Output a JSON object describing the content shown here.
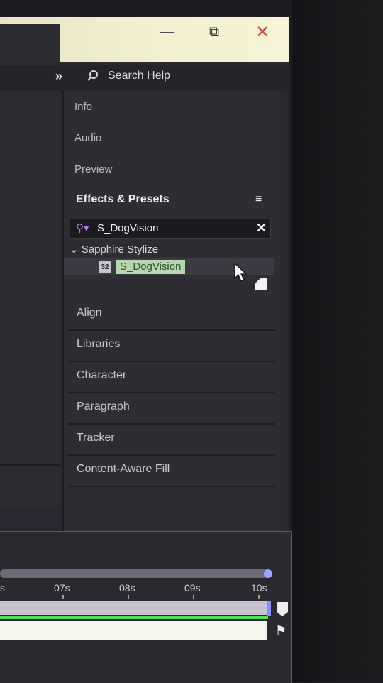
{
  "window": {
    "minimize": "—",
    "maximize": "⧉",
    "close": "✕"
  },
  "header": {
    "overflow_icon": "»",
    "search_help_icon": "search-icon",
    "search_help_label": "Search Help"
  },
  "panel_tabs": [
    "Info",
    "Audio",
    "Preview"
  ],
  "effects_presets": {
    "title": "Effects & Presets",
    "menu_icon": "≡",
    "search_value": "S_DogVision",
    "clear_icon": "✕",
    "folder": {
      "label": "Sapphire Stylize",
      "expanded": true
    },
    "item": {
      "badge": "32",
      "label": "S_DogVision",
      "highlight_color": "#b6d8ae"
    }
  },
  "stacked_panels": [
    "Align",
    "Libraries",
    "Character",
    "Paragraph",
    "Tracker",
    "Content-Aware Fill"
  ],
  "timeline": {
    "ruler": [
      {
        "label": "s"
      },
      {
        "label": "07s"
      },
      {
        "label": "08s"
      },
      {
        "label": "09s"
      },
      {
        "label": "10s"
      }
    ],
    "work_area_color": "#c7c4d0",
    "cti_color": "#8a8dff",
    "green_bar_color": "#4fe35f"
  }
}
